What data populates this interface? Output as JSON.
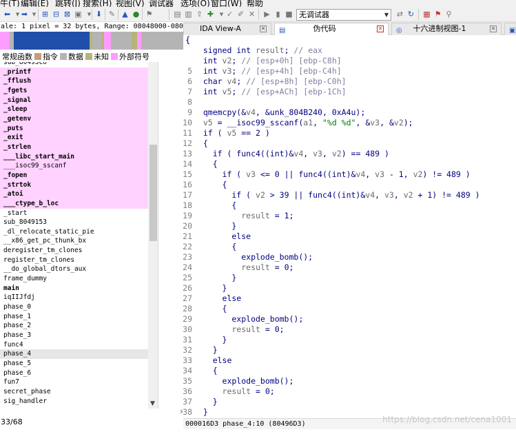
{
  "menu": [
    "牛(T)",
    "编辑(E)",
    "跳转(J)",
    "搜索(H)",
    "视图(V)",
    "调试器",
    "选项(O)",
    "窗口(W)",
    "帮助"
  ],
  "toolbar": {
    "debugger_value": "无调试器"
  },
  "scale_text": "ale: 1 pixel = 32 bytes, Range: 08048000-0804D974",
  "legend": [
    {
      "label": "常规函数",
      "color": "#a06b4f"
    },
    {
      "label": "指令",
      "color": "#c89b7b"
    },
    {
      "label": "数据",
      "color": "#b4b4b4"
    },
    {
      "label": "未知",
      "color": "#b5b57a"
    },
    {
      "label": "外部符号",
      "color": "#ff9cff"
    }
  ],
  "navbar_colors": {
    "code": "#1f4fa8",
    "lib": "#ff9cff",
    "data": "#b4b4b4",
    "unknown": "#b5b57a"
  },
  "functions": [
    {
      "name": "sub_80495Co",
      "kind": "normal"
    },
    {
      "name": "_printf",
      "kind": "lib"
    },
    {
      "name": "_fflush",
      "kind": "lib"
    },
    {
      "name": "_fgets",
      "kind": "lib"
    },
    {
      "name": "_signal",
      "kind": "lib"
    },
    {
      "name": "_sleep",
      "kind": "lib"
    },
    {
      "name": "_getenv",
      "kind": "lib"
    },
    {
      "name": "_puts",
      "kind": "lib"
    },
    {
      "name": "_exit",
      "kind": "lib"
    },
    {
      "name": "_strlen",
      "kind": "lib"
    },
    {
      "name": "___libc_start_main",
      "kind": "lib"
    },
    {
      "name": "___isoc99_sscanf",
      "kind": "lib-normal"
    },
    {
      "name": "_fopen",
      "kind": "lib"
    },
    {
      "name": "_strtok",
      "kind": "lib"
    },
    {
      "name": "_atoi",
      "kind": "lib"
    },
    {
      "name": "___ctype_b_loc",
      "kind": "lib"
    },
    {
      "name": "_start",
      "kind": "normal"
    },
    {
      "name": "sub_8049153",
      "kind": "normal"
    },
    {
      "name": "_dl_relocate_static_pie",
      "kind": "normal"
    },
    {
      "name": "__x86_get_pc_thunk_bx",
      "kind": "normal"
    },
    {
      "name": "deregister_tm_clones",
      "kind": "normal"
    },
    {
      "name": "register_tm_clones",
      "kind": "normal"
    },
    {
      "name": "__do_global_dtors_aux",
      "kind": "normal"
    },
    {
      "name": "frame_dummy",
      "kind": "normal"
    },
    {
      "name": "main",
      "kind": "bold"
    },
    {
      "name": "iqIIJfdj",
      "kind": "normal"
    },
    {
      "name": "phase_0",
      "kind": "normal"
    },
    {
      "name": "phase_1",
      "kind": "normal"
    },
    {
      "name": "phase_2",
      "kind": "normal"
    },
    {
      "name": "phase_3",
      "kind": "normal"
    },
    {
      "name": "func4",
      "kind": "normal"
    },
    {
      "name": "phase_4",
      "kind": "selected"
    },
    {
      "name": "phase_5",
      "kind": "normal"
    },
    {
      "name": "phase_6",
      "kind": "normal"
    },
    {
      "name": "fun7",
      "kind": "normal"
    },
    {
      "name": "secret_phase",
      "kind": "normal"
    },
    {
      "name": "sig_handler",
      "kind": "normal"
    }
  ],
  "function_count": "33/68",
  "tabs": [
    {
      "label": "IDA View-A",
      "active": false
    },
    {
      "label": "伪代码",
      "active": true
    },
    {
      "label": "十六进制视图-1",
      "active": false
    }
  ],
  "code_lines": [
    {
      "n": "",
      "bp": false,
      "text": "  signed int result; // eax"
    },
    {
      "n": "",
      "bp": false,
      "text": "  int v2; // [esp+0h] [ebp-C8h]"
    },
    {
      "n": "5",
      "bp": false,
      "text": "  int v3; // [esp+4h] [ebp-C4h]"
    },
    {
      "n": "6",
      "bp": false,
      "text": "  char v4; // [esp+8h] [ebp-C0h]"
    },
    {
      "n": "7",
      "bp": false,
      "text": "  int v5; // [esp+ACh] [ebp-1Ch]"
    },
    {
      "n": "8",
      "bp": false,
      "text": ""
    },
    {
      "n": "9",
      "bp": true,
      "text": "  qmemcpy(&v4, &unk_804B240, 0xA4u);"
    },
    {
      "n": "10",
      "bp": true,
      "text": "  v5 = __isoc99_sscanf(a1, \"%d %d\", &v3, &v2);"
    },
    {
      "n": "11",
      "bp": true,
      "text": "  if ( v5 == 2 )"
    },
    {
      "n": "12",
      "bp": false,
      "text": "  {"
    },
    {
      "n": "13",
      "bp": true,
      "text": "    if ( func4((int)&v4, v3, v2) == 489 )"
    },
    {
      "n": "14",
      "bp": false,
      "text": "    {"
    },
    {
      "n": "15",
      "bp": true,
      "text": "      if ( v3 <= 0 || func4((int)&v4, v3 - 1, v2) != 489 )"
    },
    {
      "n": "16",
      "bp": false,
      "text": "      {"
    },
    {
      "n": "17",
      "bp": true,
      "text": "        if ( v2 > 39 || func4((int)&v4, v3, v2 + 1) != 489 )"
    },
    {
      "n": "18",
      "bp": false,
      "text": "        {"
    },
    {
      "n": "19",
      "bp": true,
      "text": "          result = 1;"
    },
    {
      "n": "20",
      "bp": false,
      "text": "        }"
    },
    {
      "n": "21",
      "bp": false,
      "text": "        else"
    },
    {
      "n": "22",
      "bp": false,
      "text": "        {"
    },
    {
      "n": "23",
      "bp": true,
      "text": "          explode_bomb();"
    },
    {
      "n": "24",
      "bp": true,
      "text": "          result = 0;"
    },
    {
      "n": "25",
      "bp": false,
      "text": "        }"
    },
    {
      "n": "26",
      "bp": false,
      "text": "      }"
    },
    {
      "n": "27",
      "bp": false,
      "text": "      else"
    },
    {
      "n": "28",
      "bp": false,
      "text": "      {"
    },
    {
      "n": "29",
      "bp": true,
      "text": "        explode_bomb();"
    },
    {
      "n": "30",
      "bp": true,
      "text": "        result = 0;"
    },
    {
      "n": "31",
      "bp": false,
      "text": "      }"
    },
    {
      "n": "32",
      "bp": false,
      "text": "    }"
    },
    {
      "n": "33",
      "bp": false,
      "text": "    else"
    },
    {
      "n": "34",
      "bp": false,
      "text": "    {"
    },
    {
      "n": "35",
      "bp": true,
      "text": "      explode_bomb();"
    },
    {
      "n": "36",
      "bp": true,
      "text": "      result = 0;"
    },
    {
      "n": "37",
      "bp": false,
      "text": "    }"
    },
    {
      "n": "38",
      "bp": false,
      "text": "  }"
    }
  ],
  "status_text": "000016D3 phase_4:10 (80496D3)",
  "watermark": "https://blog.csdn.net/cena1001"
}
